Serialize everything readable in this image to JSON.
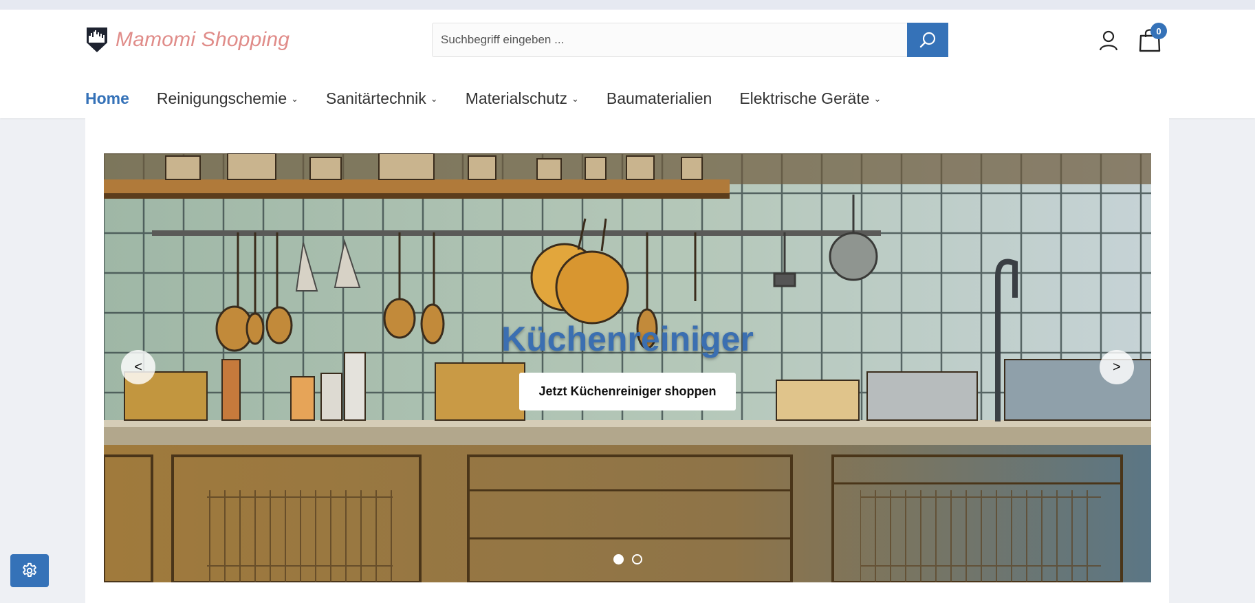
{
  "brand": {
    "name": "Mamomi Shopping",
    "logo_icon": "city-shield-logo",
    "text_color": "#e08c89",
    "accent_color": "#3572b8"
  },
  "search": {
    "value": "",
    "placeholder": "Suchbegriff eingeben ...",
    "button_icon": "search-icon"
  },
  "header_actions": {
    "account_icon": "user-icon",
    "cart_icon": "shopping-bag-icon",
    "cart_count": "0"
  },
  "nav": {
    "items": [
      {
        "label": "Home",
        "active": true,
        "has_dropdown": false
      },
      {
        "label": "Reinigungschemie",
        "active": false,
        "has_dropdown": true
      },
      {
        "label": "Sanitärtechnik",
        "active": false,
        "has_dropdown": true
      },
      {
        "label": "Materialschutz",
        "active": false,
        "has_dropdown": true
      },
      {
        "label": "Baumaterialien",
        "active": false,
        "has_dropdown": false
      },
      {
        "label": "Elektrische Geräte",
        "active": false,
        "has_dropdown": true
      }
    ],
    "dropdown_glyph": "⌄"
  },
  "hero": {
    "title": "Küchenreiniger",
    "cta_label": "Jetzt Küchenreiniger shoppen",
    "prev_label": "<",
    "next_label": ">",
    "slide_count": 2,
    "active_slide": 1,
    "image_subject": "illustrated kitchen with hanging utensils and tiled wall"
  },
  "floating": {
    "settings_icon": "gear-icon"
  }
}
